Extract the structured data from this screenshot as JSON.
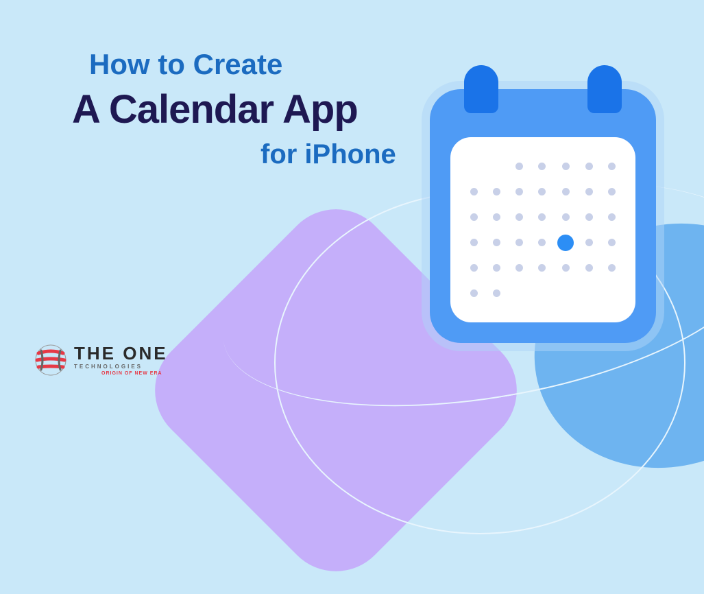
{
  "heading": {
    "line1": "How to Create",
    "line2": "A Calendar App",
    "line3": "for iPhone"
  },
  "logo": {
    "main": "THE ONE",
    "sub": "TECHNOLOGIES",
    "tagline": "ORIGIN OF NEW ERA"
  },
  "calendar": {
    "rows": 6,
    "cols": 7,
    "highlight_row": 3,
    "highlight_col": 4,
    "empty_start_cells": 2,
    "empty_end_cells": 5
  },
  "colors": {
    "bg": "#c9e8f9",
    "heading_blue": "#1b6bc0",
    "heading_dark": "#1e1852",
    "calendar_blue": "#4f9bf5",
    "ring_blue": "#1a73e8",
    "dot_gray": "#c8d0e8",
    "dot_highlight": "#2c8ef5",
    "shape_purple": "#c5affa",
    "shape_blue": "#6eb4f0",
    "logo_red": "#e63946"
  }
}
